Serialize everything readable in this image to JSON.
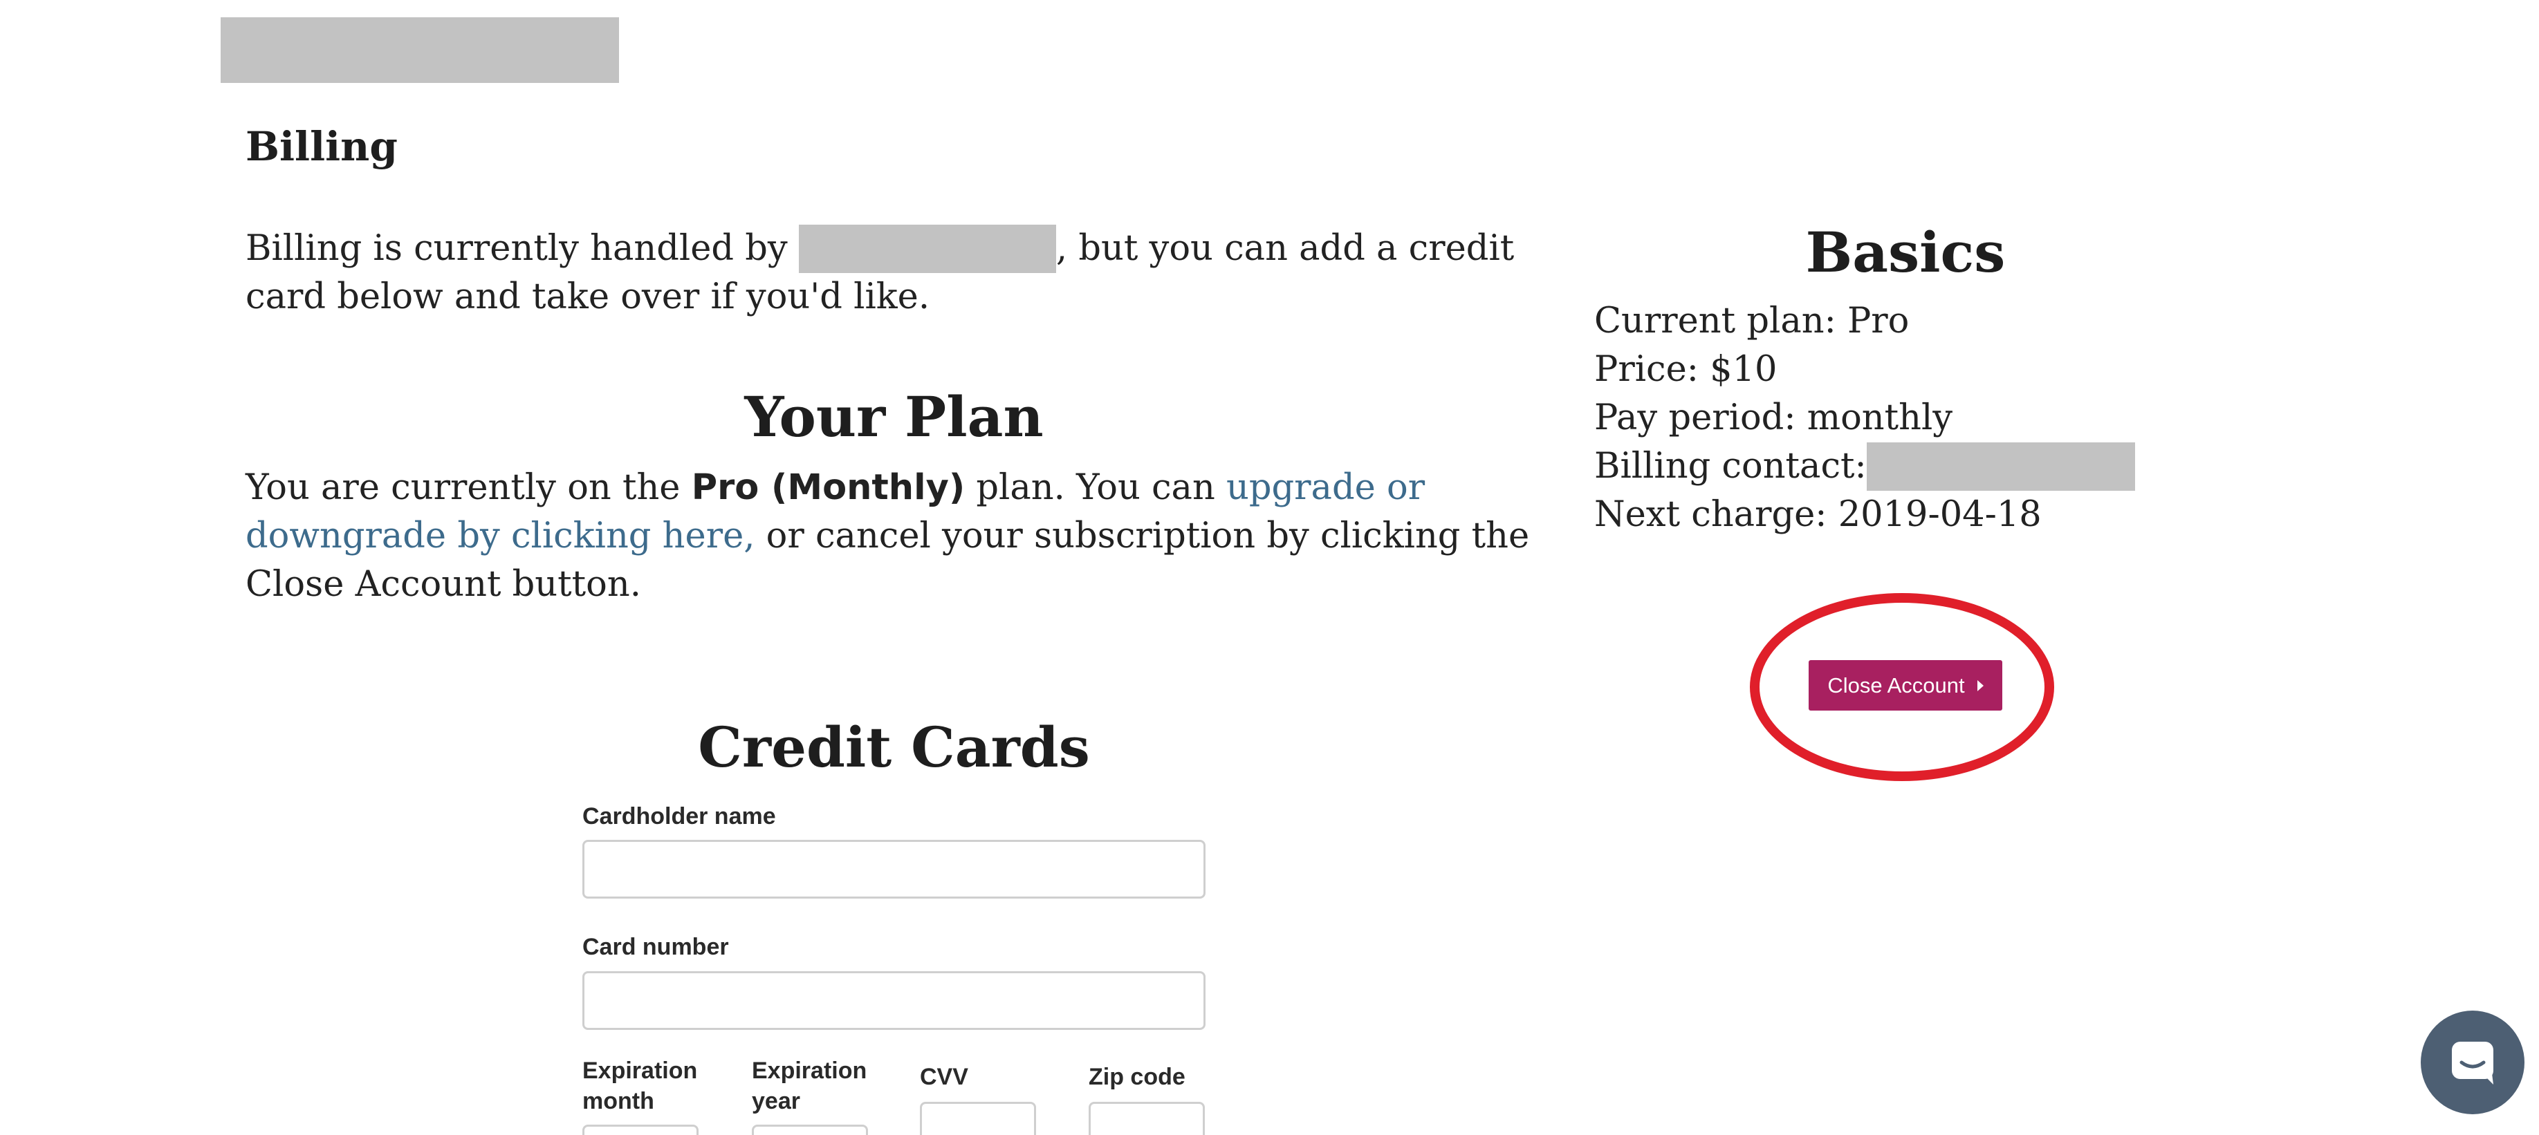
{
  "header": {
    "page_title": "Billing"
  },
  "intro": {
    "text_before": "Billing is currently handled by ",
    "text_after": ", but you can add a credit card below and take over if you'd like."
  },
  "your_plan": {
    "heading": "Your Plan",
    "text_1": "You are currently on the ",
    "plan_name": "Pro (Monthly)",
    "text_2": " plan. You can ",
    "link_text": "upgrade or downgrade by clicking here,",
    "text_3": " or cancel your subscription by clicking the Close Account button."
  },
  "credit_cards": {
    "heading": "Credit Cards",
    "cardholder_label": "Cardholder name",
    "cardholder_value": "",
    "card_number_label": "Card number",
    "card_number_value": "",
    "exp_month_label": "Expiration month",
    "exp_year_label": "Expiration year",
    "cvv_label": "CVV",
    "zip_label": "Zip code"
  },
  "basics": {
    "heading": "Basics",
    "current_plan": "Current plan: Pro",
    "price": "Price: $10",
    "pay_period": "Pay period: monthly",
    "billing_contact_label": "Billing contact:",
    "next_charge": "Next charge: 2019-04-18"
  },
  "close_account": {
    "label": "Close Account",
    "icon": "caret-right-icon",
    "color": "#a82060",
    "annotation_color": "#e01f2a"
  },
  "chat": {
    "icon": "chat-bubble-icon",
    "color": "#4d5f73"
  }
}
